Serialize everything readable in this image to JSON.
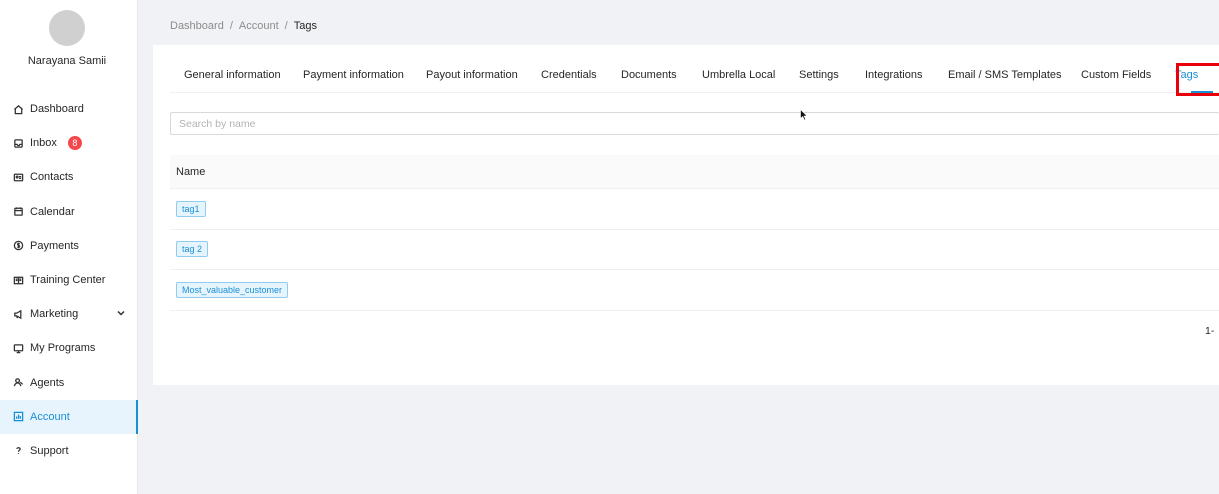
{
  "user": {
    "name": "Narayana Samii"
  },
  "sidebar": {
    "items": [
      {
        "label": "Dashboard",
        "icon": "home-icon"
      },
      {
        "label": "Inbox",
        "icon": "inbox-icon",
        "badge": "8"
      },
      {
        "label": "Contacts",
        "icon": "contacts-icon"
      },
      {
        "label": "Calendar",
        "icon": "calendar-icon"
      },
      {
        "label": "Payments",
        "icon": "dollar-icon"
      },
      {
        "label": "Training Center",
        "icon": "book-icon"
      },
      {
        "label": "Marketing",
        "icon": "megaphone-icon"
      },
      {
        "label": "My Programs",
        "icon": "monitor-icon"
      },
      {
        "label": "Agents",
        "icon": "agents-icon"
      },
      {
        "label": "Account",
        "icon": "account-icon",
        "active": true
      },
      {
        "label": "Support",
        "icon": "help-icon"
      }
    ]
  },
  "breadcrumb": {
    "items": [
      "Dashboard",
      "Account",
      "Tags"
    ],
    "separator": "/"
  },
  "tabs": [
    "General information",
    "Payment information",
    "Payout information",
    "Credentials",
    "Documents",
    "Umbrella Local",
    "Settings",
    "Integrations",
    "Email / SMS Templates",
    "Custom Fields",
    "Tags"
  ],
  "search": {
    "placeholder": "Search by name",
    "value": ""
  },
  "table": {
    "headers": [
      "Name"
    ],
    "rows": [
      {
        "tag": "tag1"
      },
      {
        "tag": "tag 2"
      },
      {
        "tag": "Most_valuable_customer"
      }
    ]
  },
  "pagination": {
    "text": "1-"
  },
  "colors": {
    "accent": "#1a8fd6",
    "highlight": "#e8000b",
    "badge": "#f5484d"
  }
}
